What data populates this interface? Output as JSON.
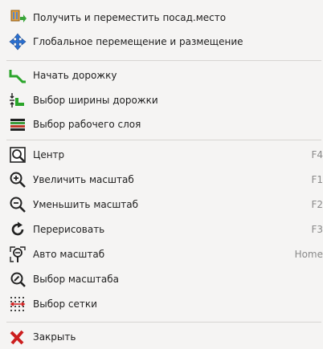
{
  "menu": {
    "items": [
      {
        "label": "Получить и переместить посад.место",
        "shortcut": "",
        "icon": "get-and-move-footprint-icon"
      },
      {
        "label": "Глобальное перемещение и размещение",
        "shortcut": "",
        "icon": "global-move-and-place-icon"
      },
      {
        "label": "Начать дорожку",
        "shortcut": "",
        "icon": "start-track-icon"
      },
      {
        "label": "Выбор ширины дорожки",
        "shortcut": "",
        "icon": "track-width-icon"
      },
      {
        "label": "Выбор рабочего слоя",
        "shortcut": "",
        "icon": "working-layer-icon"
      },
      {
        "label": "Центр",
        "shortcut": "F4",
        "icon": "center-icon"
      },
      {
        "label": "Увеличить масштаб",
        "shortcut": "F1",
        "icon": "zoom-in-icon"
      },
      {
        "label": "Уменьшить масштаб",
        "shortcut": "F2",
        "icon": "zoom-out-icon"
      },
      {
        "label": "Перерисовать",
        "shortcut": "F3",
        "icon": "redraw-icon"
      },
      {
        "label": "Авто масштаб",
        "shortcut": "Home",
        "icon": "auto-zoom-icon"
      },
      {
        "label": "Выбор масштаба",
        "shortcut": "",
        "icon": "zoom-select-icon"
      },
      {
        "label": "Выбор сетки",
        "shortcut": "",
        "icon": "grid-select-icon"
      },
      {
        "label": "Закрыть",
        "shortcut": "",
        "icon": "close-icon"
      }
    ]
  },
  "colors": {
    "background": "#f5f4f3",
    "separator": "#d7d5d2",
    "shortcut_text": "#8a8a8a",
    "green": "#2aa52a",
    "close_red": "#cc1e1e"
  }
}
